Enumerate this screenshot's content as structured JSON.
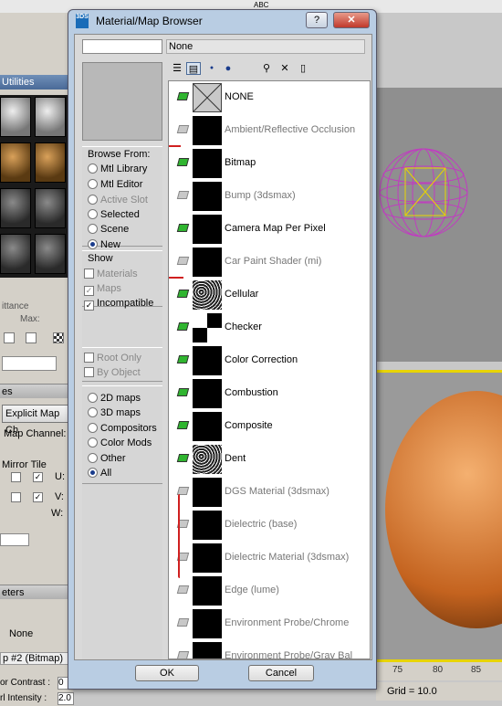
{
  "background": {
    "top_tab": "ABC",
    "utilities_label": "Utilities",
    "mittance_label": "ittance",
    "max_label": "Max:",
    "map_rollout": "es",
    "explicit_map_btn": "Explicit Map Ch",
    "map_channel": "Map Channel:",
    "mirror_tile": "Mirror Tile",
    "u_label": "U:",
    "v_label": "V:",
    "w_label": "W:",
    "params_rollout": "eters",
    "none_label": "None",
    "map_title": "p #2 (Bitmap)",
    "contrast_label": "or Contrast :",
    "contrast_value": "0",
    "intensity_label": "rl Intensity :",
    "intensity_value": "2.0",
    "ruler_75": "75",
    "ruler_80": "80",
    "ruler_85": "85",
    "grid_label": "Grid = 10.0"
  },
  "dialog": {
    "title": "Material/Map Browser",
    "icon_text": "3DS",
    "help_btn": "?",
    "close_btn": "✕",
    "name_value": "None",
    "browse_from": {
      "title": "Browse From:",
      "options": [
        {
          "label": "Mtl Library",
          "selected": false,
          "disabled": false
        },
        {
          "label": "Mtl Editor",
          "selected": false,
          "disabled": false
        },
        {
          "label": "Active Slot",
          "selected": false,
          "disabled": true
        },
        {
          "label": "Selected",
          "selected": false,
          "disabled": false
        },
        {
          "label": "Scene",
          "selected": false,
          "disabled": false
        },
        {
          "label": "New",
          "selected": true,
          "disabled": false
        }
      ]
    },
    "show": {
      "title": "Show",
      "options": [
        {
          "label": "Materials",
          "checked": false,
          "disabled": true
        },
        {
          "label": "Maps",
          "checked": true,
          "disabled": true
        },
        {
          "label": "Incompatible",
          "checked": true,
          "disabled": false
        }
      ]
    },
    "root_only": "Root Only",
    "by_object": "By Object",
    "map_types": [
      {
        "label": "2D maps",
        "selected": false
      },
      {
        "label": "3D maps",
        "selected": false
      },
      {
        "label": "Compositors",
        "selected": false
      },
      {
        "label": "Color Mods",
        "selected": false
      },
      {
        "label": "Other",
        "selected": false
      },
      {
        "label": "All",
        "selected": true
      }
    ],
    "items": [
      {
        "label": "NONE",
        "incompatible": false,
        "swatch": "none"
      },
      {
        "label": "Ambient/Reflective Occlusion",
        "incompatible": true,
        "swatch": "black"
      },
      {
        "label": "Bitmap",
        "incompatible": false,
        "swatch": "black"
      },
      {
        "label": "Bump (3dsmax)",
        "incompatible": true,
        "swatch": "black"
      },
      {
        "label": "Camera Map Per Pixel",
        "incompatible": false,
        "swatch": "black"
      },
      {
        "label": "Car Paint Shader (mi)",
        "incompatible": true,
        "swatch": "black"
      },
      {
        "label": "Cellular",
        "incompatible": false,
        "swatch": "noise"
      },
      {
        "label": "Checker",
        "incompatible": false,
        "swatch": "checker"
      },
      {
        "label": "Color Correction",
        "incompatible": false,
        "swatch": "black"
      },
      {
        "label": "Combustion",
        "incompatible": false,
        "swatch": "black"
      },
      {
        "label": "Composite",
        "incompatible": false,
        "swatch": "black"
      },
      {
        "label": "Dent",
        "incompatible": false,
        "swatch": "noise"
      },
      {
        "label": "DGS Material (3dsmax)",
        "incompatible": true,
        "swatch": "black"
      },
      {
        "label": "Dielectric (base)",
        "incompatible": true,
        "swatch": "black"
      },
      {
        "label": "Dielectric Material (3dsmax)",
        "incompatible": true,
        "swatch": "black"
      },
      {
        "label": "Edge (lume)",
        "incompatible": true,
        "swatch": "black"
      },
      {
        "label": "Environment Probe/Chrome",
        "incompatible": true,
        "swatch": "black"
      },
      {
        "label": "Environment Probe/Gray Bal",
        "incompatible": true,
        "swatch": "black"
      }
    ],
    "ok_label": "OK",
    "cancel_label": "Cancel"
  }
}
